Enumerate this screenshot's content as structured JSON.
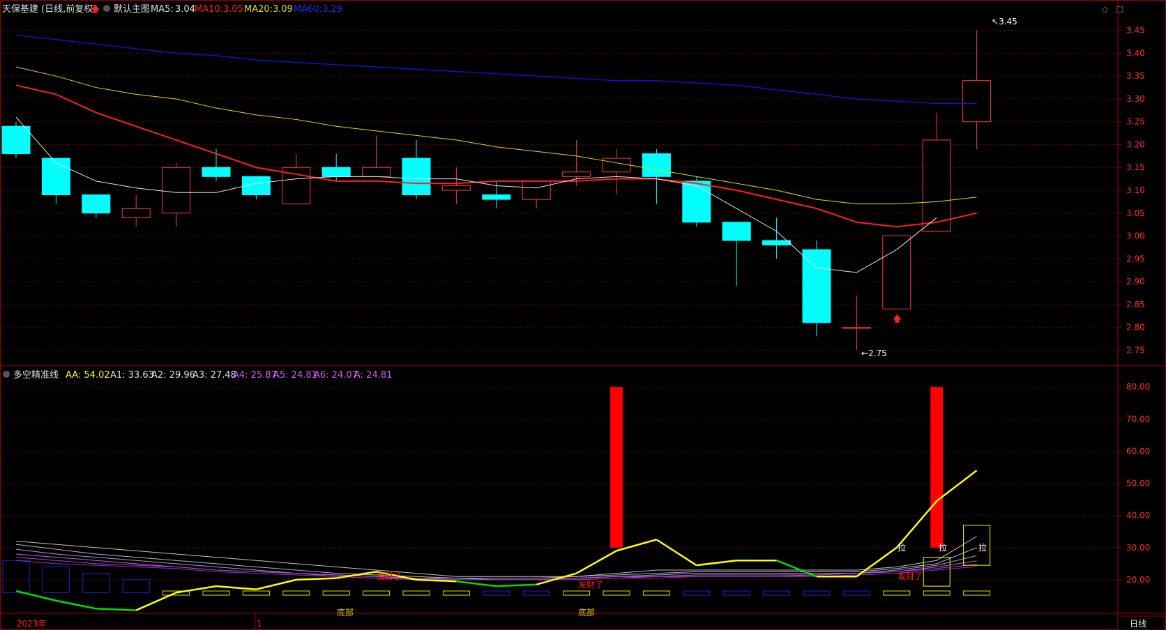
{
  "main_header": {
    "stock_name": "天保基建",
    "period": "(日线,前复权)",
    "up_arrow": "🡅",
    "chart_mode": "默认主图",
    "ma5_label": "MA5:",
    "ma5_value": "3.04",
    "ma10_label": "MA10:",
    "ma10_value": "3.05",
    "ma20_label": "MA20:",
    "ma20_value": "3.09",
    "ma60_label": "MA60:",
    "ma60_value": "3.29"
  },
  "sub_header": {
    "indicator_name": "多空精准线",
    "aa": "AA: 54.02",
    "a1": "A1: 33.63",
    "a2": "A2: 29.96",
    "a3": "A3: 27.48",
    "a4": "A4: 25.87",
    "a5": "A5: 24.81",
    "a6": "A6: 24.07",
    "a": "A: 24.81"
  },
  "bottom": {
    "year_label": "2023年",
    "month_label": "1",
    "period_button": "日线"
  },
  "main_axis_ticks": [
    "3.45",
    "3.40",
    "3.35",
    "3.30",
    "3.25",
    "3.20",
    "3.15",
    "3.10",
    "3.05",
    "3.00",
    "2.95",
    "2.90",
    "2.85",
    "2.80",
    "2.75"
  ],
  "sub_axis_ticks": [
    "80.00",
    "70.00",
    "60.00",
    "50.00",
    "40.00",
    "30.00",
    "20.00"
  ],
  "annotations": {
    "high": "3.45",
    "low": "2.75",
    "bottom1": "底部",
    "bottom2": "底部",
    "facai1": "发财了",
    "facai2": "发财了",
    "facai3": "发财了",
    "la1": "拉",
    "la2": "拉",
    "la3": "拉"
  },
  "colors": {
    "up": "#ff3b3b",
    "down": "#00ffff",
    "ma5": "#e6e6e6",
    "ma10": "#ff2020",
    "ma20": "#e0e000",
    "ma60": "#1010d0",
    "aa": "#ffff00",
    "green": "#00e000",
    "signal": "#ff0000",
    "grid": "#7a0000",
    "border": "#a00000"
  },
  "chart_data": [
    {
      "type": "candlestick",
      "x": [
        1,
        2,
        3,
        4,
        5,
        6,
        7,
        8,
        9,
        10,
        11,
        12,
        13,
        14,
        15,
        16,
        17,
        18,
        19,
        20,
        21,
        22,
        23,
        24,
        25
      ],
      "open": [
        3.24,
        3.17,
        3.09,
        3.04,
        3.05,
        3.15,
        3.13,
        3.07,
        3.15,
        3.13,
        3.17,
        3.1,
        3.09,
        3.08,
        3.13,
        3.14,
        3.18,
        3.12,
        3.03,
        2.99,
        2.97,
        2.8,
        2.84,
        3.01,
        3.25
      ],
      "high": [
        3.25,
        3.17,
        3.09,
        3.09,
        3.16,
        3.19,
        3.13,
        3.18,
        3.18,
        3.22,
        3.21,
        3.15,
        3.12,
        3.12,
        3.21,
        3.19,
        3.19,
        3.13,
        3.03,
        3.04,
        2.99,
        2.87,
        3.0,
        3.27,
        3.45
      ],
      "low": [
        3.17,
        3.07,
        3.04,
        3.02,
        3.02,
        3.12,
        3.08,
        3.07,
        3.12,
        3.13,
        3.08,
        3.07,
        3.06,
        3.06,
        3.11,
        3.09,
        3.07,
        3.02,
        2.89,
        2.95,
        2.78,
        2.75,
        2.84,
        3.01,
        3.19
      ],
      "close": [
        3.18,
        3.09,
        3.05,
        3.06,
        3.15,
        3.13,
        3.09,
        3.15,
        3.13,
        3.15,
        3.09,
        3.11,
        3.08,
        3.12,
        3.14,
        3.17,
        3.13,
        3.03,
        2.99,
        2.98,
        2.81,
        2.8,
        3.0,
        3.21,
        3.34
      ],
      "ma5": [
        3.26,
        3.16,
        3.12,
        3.105,
        3.095,
        3.095,
        3.115,
        3.125,
        3.13,
        3.13,
        3.125,
        3.125,
        3.11,
        3.105,
        3.125,
        3.13,
        3.125,
        3.11,
        3.06,
        3.01,
        2.93,
        2.92,
        2.97,
        3.04
      ],
      "ma10": [
        3.33,
        3.31,
        3.27,
        3.24,
        3.21,
        3.18,
        3.15,
        3.135,
        3.12,
        3.12,
        3.115,
        3.115,
        3.12,
        3.12,
        3.12,
        3.125,
        3.125,
        3.115,
        3.1,
        3.08,
        3.06,
        3.03,
        3.02,
        3.03,
        3.05
      ],
      "ma20": [
        3.37,
        3.35,
        3.325,
        3.31,
        3.3,
        3.28,
        3.265,
        3.255,
        3.24,
        3.23,
        3.22,
        3.21,
        3.195,
        3.185,
        3.175,
        3.16,
        3.145,
        3.13,
        3.115,
        3.1,
        3.08,
        3.07,
        3.07,
        3.075,
        3.085
      ],
      "ma60": [
        3.44,
        3.43,
        3.42,
        3.41,
        3.4,
        3.395,
        3.385,
        3.38,
        3.375,
        3.37,
        3.365,
        3.36,
        3.355,
        3.35,
        3.345,
        3.34,
        3.34,
        3.335,
        3.33,
        3.32,
        3.31,
        3.3,
        3.295,
        3.29,
        3.29
      ],
      "ylim": [
        2.72,
        3.48
      ],
      "grid": true
    },
    {
      "type": "line",
      "x": [
        1,
        2,
        3,
        4,
        5,
        6,
        7,
        8,
        9,
        10,
        11,
        12,
        13,
        14,
        15,
        16,
        17,
        18,
        19,
        20,
        21,
        22,
        23,
        24,
        25
      ],
      "aa": [
        16.5,
        13.5,
        11,
        10.5,
        16,
        18,
        17,
        20,
        20.5,
        22.5,
        20,
        19.5,
        18,
        18.5,
        22,
        29,
        32.5,
        24.5,
        26,
        26,
        21,
        21,
        30,
        44.5,
        54
      ],
      "ma_lines": [
        {
          "name": "A1",
          "values": [
            32,
            31,
            30,
            29,
            28,
            27,
            26,
            25,
            24,
            23,
            22,
            21,
            21,
            21,
            21,
            22,
            23,
            23,
            23,
            23,
            23,
            23,
            24,
            26,
            33.5
          ]
        },
        {
          "name": "A2",
          "values": [
            31,
            29.5,
            28,
            27,
            26,
            25,
            24,
            23,
            22,
            21.5,
            21,
            20.5,
            20.5,
            20.5,
            21,
            21.5,
            22,
            22.5,
            22.5,
            22.5,
            22.5,
            22.5,
            23.5,
            25,
            30
          ]
        },
        {
          "name": "A3",
          "values": [
            29.5,
            28,
            27,
            26,
            25,
            24,
            23,
            22,
            21.5,
            21,
            20.5,
            20.5,
            20,
            20,
            20.5,
            21,
            21.5,
            22,
            22,
            22,
            22,
            22,
            23,
            24.5,
            27.5
          ]
        },
        {
          "name": "A4",
          "values": [
            28,
            27,
            26,
            25,
            24,
            23,
            22.5,
            22,
            21.5,
            21,
            20.5,
            20,
            20,
            20,
            20.5,
            21,
            21,
            21.5,
            21.5,
            21.5,
            21.5,
            22,
            22.5,
            24,
            25.9
          ]
        },
        {
          "name": "A5",
          "values": [
            27,
            26,
            25,
            24.5,
            24,
            23,
            22.5,
            22,
            21,
            20.5,
            20.5,
            20,
            20,
            20,
            20,
            20.5,
            21,
            21,
            21,
            21,
            21.5,
            22,
            22.5,
            23.5,
            24.8
          ]
        },
        {
          "name": "A6",
          "values": [
            26,
            25,
            24.5,
            24,
            23.5,
            22.5,
            22,
            21.5,
            21,
            20.5,
            20,
            20,
            20,
            20,
            20,
            20.5,
            20.5,
            21,
            21,
            21,
            21,
            21.5,
            22,
            23,
            24.1
          ]
        }
      ],
      "signals": [
        15,
        23
      ],
      "ylim": [
        10,
        82
      ],
      "grid": true
    }
  ]
}
